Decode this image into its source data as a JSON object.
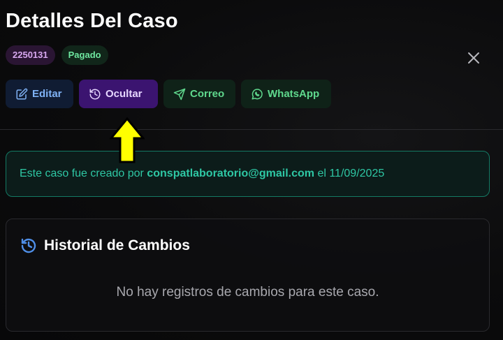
{
  "header": {
    "title": "Detalles Del Caso"
  },
  "badges": {
    "case_id": "2250131",
    "status": "Pagado"
  },
  "actions": {
    "edit_label": "Editar",
    "hide_label": "Ocultar",
    "mail_label": "Correo",
    "whatsapp_label": "WhatsApp"
  },
  "info": {
    "prefix": "Este caso fue creado por ",
    "email": "conspatlaboratorio@gmail.com",
    "middle": " el ",
    "date": "11/09/2025"
  },
  "history": {
    "title": "Historial de Cambios",
    "empty_message": "No hay registros de cambios para este caso."
  },
  "icons": {
    "close": "close-icon",
    "edit": "edit-icon",
    "history": "history-icon",
    "send": "send-icon",
    "whatsapp": "whatsapp-icon",
    "annotation": "arrow-up-icon"
  },
  "colors": {
    "accent_purple": "#3b1470",
    "accent_green": "#5fd88d",
    "accent_teal": "#2ec7a4",
    "accent_blue": "#7fb2f5",
    "annotation_yellow": "#ffff00"
  }
}
